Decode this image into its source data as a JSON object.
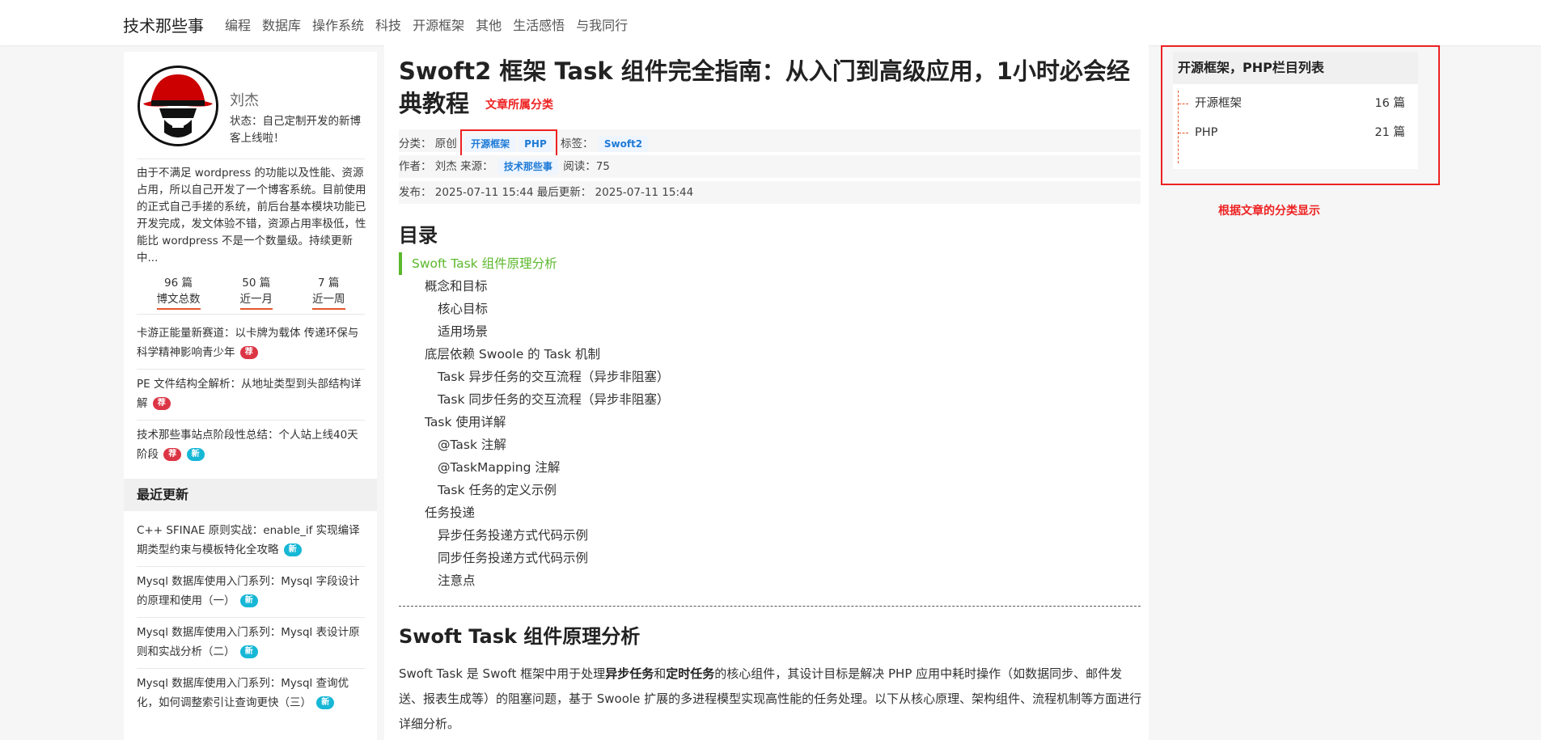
{
  "nav": {
    "brand": "技术那些事",
    "items": [
      "编程",
      "数据库",
      "操作系统",
      "科技",
      "开源框架",
      "其他",
      "生活感悟",
      "与我同行"
    ]
  },
  "profile": {
    "name": "刘杰",
    "status": "状态：自己定制开发的新博客上线啦！",
    "intro": "由于不满足 wordpress 的功能以及性能、资源占用，所以自己开发了一个博客系统。目前使用的正式自己手搓的系统，前后台基本模块功能已开发完成，发文体验不错，资源占用率极低，性能比 wordpress 不是一个数量级。持续更新中...",
    "stats": [
      {
        "num": "96 篇",
        "label": "博文总数"
      },
      {
        "num": "50 篇",
        "label": "近一月"
      },
      {
        "num": "7 篇",
        "label": "近一周"
      }
    ]
  },
  "recommended": [
    {
      "text": "卡游正能量新赛道：以卡牌为载体 传递环保与科学精神影响青少年",
      "badges": [
        "荐"
      ]
    },
    {
      "text": "PE 文件结构全解析：从地址类型到头部结构详解",
      "badges": [
        "荐"
      ]
    },
    {
      "text": "技术那些事站点阶段性总结：个人站上线40天阶段",
      "badges": [
        "荐",
        "新"
      ]
    }
  ],
  "recent": {
    "heading": "最近更新",
    "items": [
      {
        "text": "C++ SFINAE 原则实战：enable_if 实现编译期类型约束与模板特化全攻略",
        "badge": "新"
      },
      {
        "text": "Mysql 数据库使用入门系列：Mysql 字段设计的原理和使用（一）",
        "badge": "新"
      },
      {
        "text": "Mysql 数据库使用入门系列：Mysql 表设计原则和实战分析（二）",
        "badge": "新"
      },
      {
        "text": "Mysql 数据库使用入门系列：Mysql 查询优化，如何调整索引让查询更快（三）",
        "badge": "新"
      }
    ]
  },
  "article": {
    "title": "Swoft2 框架 Task 组件完全指南：从入门到高级应用，1小时必会经典教程",
    "category_note": "文章所属分类",
    "meta": {
      "category_label": "分类：",
      "original": "原创",
      "categories": [
        "开源框架",
        "PHP"
      ],
      "tags_label": "标签：",
      "tags": [
        "Swoft2"
      ],
      "author_label": "作者：",
      "author": "刘杰",
      "source_label": "来源：",
      "source": "技术那些事",
      "reads_label": "阅读：",
      "reads": "75",
      "published_label": "发布：",
      "published": "2025-07-11 15:44",
      "updated_label": "最后更新：",
      "updated": "2025-07-11 15:44"
    },
    "toc_title": "目录",
    "toc": [
      {
        "level": 1,
        "text": "Swoft Task 组件原理分析",
        "active": true
      },
      {
        "level": 2,
        "text": "概念和目标"
      },
      {
        "level": 3,
        "text": "核心目标"
      },
      {
        "level": 3,
        "text": "适用场景"
      },
      {
        "level": 2,
        "text": "底层依赖 Swoole 的 Task 机制"
      },
      {
        "level": 3,
        "text": "Task 异步任务的交互流程（异步非阻塞）"
      },
      {
        "level": 3,
        "text": "Task 同步任务的交互流程（异步非阻塞）"
      },
      {
        "level": 2,
        "text": "Task 使用详解"
      },
      {
        "level": 3,
        "text": "@Task 注解"
      },
      {
        "level": 3,
        "text": "@TaskMapping 注解"
      },
      {
        "level": 3,
        "text": "Task 任务的定义示例"
      },
      {
        "level": 2,
        "text": "任务投递"
      },
      {
        "level": 3,
        "text": "异步任务投递方式代码示例"
      },
      {
        "level": 3,
        "text": "同步任务投递方式代码示例"
      },
      {
        "level": 3,
        "text": "注意点"
      }
    ],
    "section_title": "Swoft Task 组件原理分析",
    "para_parts": {
      "p1": "Swoft Task 是 Swoft 框架中用于处理",
      "b1": "异步任务",
      "p2": "和",
      "b2": "定时任务",
      "p3": "的核心组件，其设计目标是解决 PHP 应用中耗时操作（如数据同步、邮件发送、报表生成等）的阻塞问题，基于 Swoole 扩展的多进程模型实现高性能的任务处理。以下从核心原理、架构组件、流程机制等方面进行详细分析。"
    }
  },
  "sidebar_right": {
    "title": "开源框架，PHP栏目列表",
    "items": [
      {
        "name": "开源框架",
        "count": "16 篇"
      },
      {
        "name": "PHP",
        "count": "21 篇"
      }
    ],
    "note": "根据文章的分类显示"
  },
  "colors": {
    "accent_red": "#ee2222",
    "toc_active": "#5cb82c",
    "tag_blue": "#1e7ad6",
    "badge_red": "#dc3545",
    "badge_cyan": "#17b7d6"
  }
}
